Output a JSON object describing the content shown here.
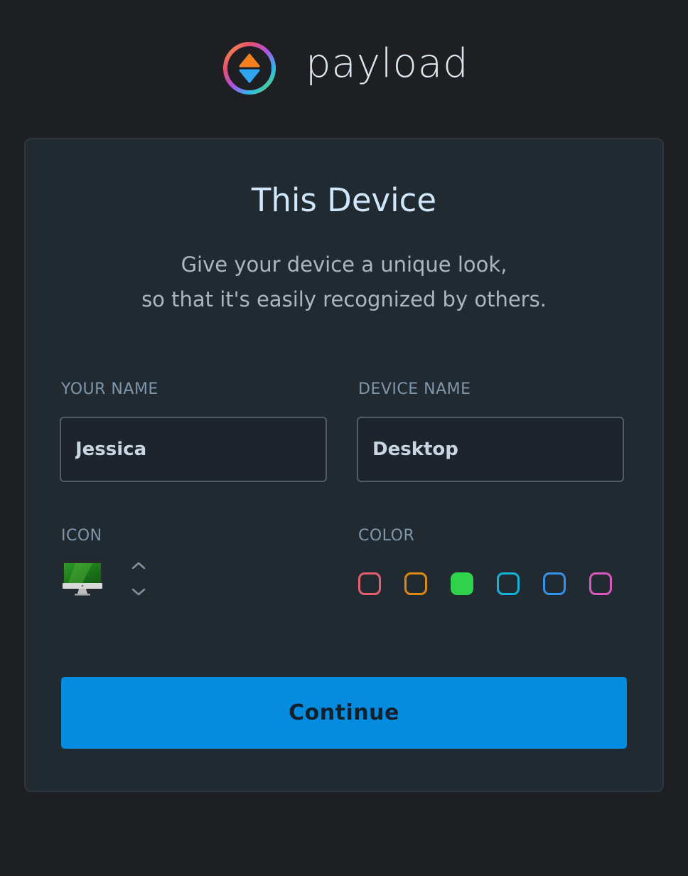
{
  "brand": {
    "name": "payload"
  },
  "card": {
    "title": "This Device",
    "subtitle_line1": "Give your device a unique look,",
    "subtitle_line2": "so that it's easily recognized by others."
  },
  "form": {
    "your_name": {
      "label": "YOUR NAME",
      "value": "Jessica"
    },
    "device_name": {
      "label": "DEVICE NAME",
      "value": "Desktop"
    },
    "icon": {
      "label": "ICON",
      "selected": "imac-icon"
    },
    "color": {
      "label": "COLOR",
      "options": [
        "#e4606f",
        "#d98a12",
        "#2fd14d",
        "#15b2da",
        "#3393ea",
        "#d858bd"
      ],
      "selected": "#2fd14d"
    }
  },
  "actions": {
    "continue_label": "Continue"
  },
  "colors": {
    "background": "#1d1f23",
    "card": "#222a31",
    "accent": "#058cdf"
  }
}
